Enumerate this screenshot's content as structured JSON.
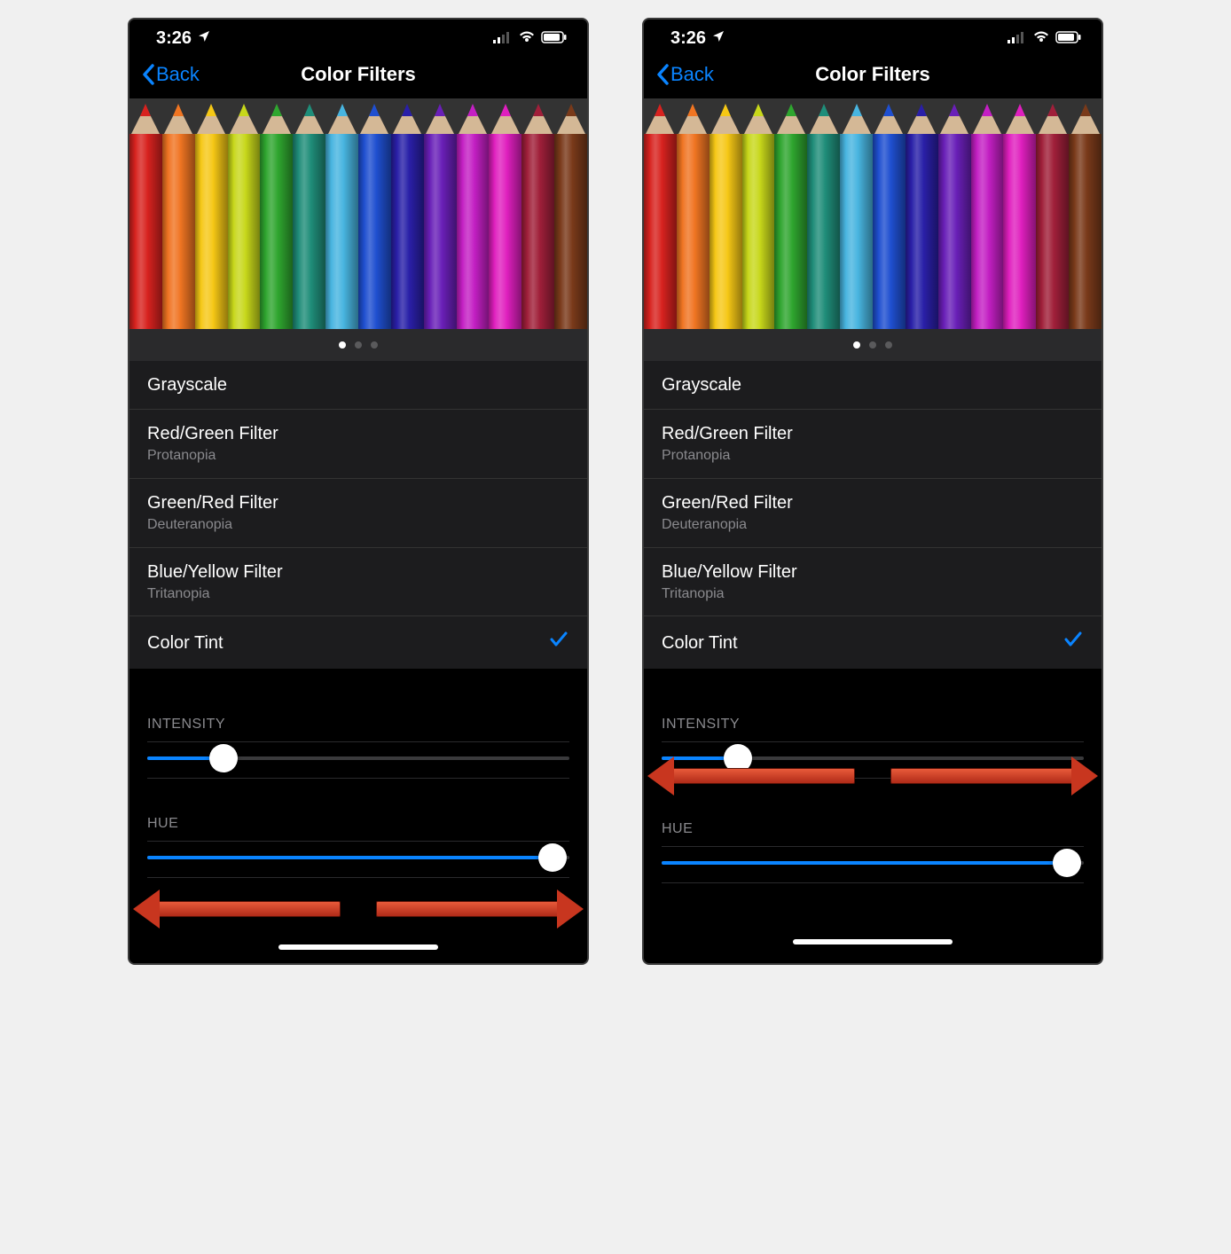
{
  "screens": [
    {
      "status": {
        "time": "3:26"
      },
      "nav": {
        "back": "Back",
        "title": "Color Filters"
      },
      "pencil_colors": [
        "#d8221f",
        "#f07522",
        "#f6c815",
        "#c8d81a",
        "#2fa62f",
        "#1f8e7a",
        "#48b5e0",
        "#1f4fd0",
        "#2a1fa8",
        "#6a1fb8",
        "#c41fc4",
        "#e01fbf",
        "#a01f3a",
        "#7a3a1a"
      ],
      "page_dots": {
        "count": 3,
        "active": 0
      },
      "filters": [
        {
          "label": "Grayscale",
          "sub": "",
          "checked": false
        },
        {
          "label": "Red/Green Filter",
          "sub": "Protanopia",
          "checked": false
        },
        {
          "label": "Green/Red Filter",
          "sub": "Deuteranopia",
          "checked": false
        },
        {
          "label": "Blue/Yellow Filter",
          "sub": "Tritanopia",
          "checked": false
        },
        {
          "label": "Color Tint",
          "sub": "",
          "checked": true
        }
      ],
      "sliders": {
        "intensity": {
          "header": "INTENSITY",
          "value": 0.18
        },
        "hue": {
          "header": "HUE",
          "value": 0.96
        }
      },
      "arrows_on": "hue"
    },
    {
      "status": {
        "time": "3:26"
      },
      "nav": {
        "back": "Back",
        "title": "Color Filters"
      },
      "pencil_colors": [
        "#d8221f",
        "#f07522",
        "#f6c815",
        "#c8d81a",
        "#2fa62f",
        "#1f8e7a",
        "#48b5e0",
        "#1f4fd0",
        "#2a1fa8",
        "#6a1fb8",
        "#c41fc4",
        "#e01fbf",
        "#a01f3a",
        "#7a3a1a"
      ],
      "page_dots": {
        "count": 3,
        "active": 0
      },
      "filters": [
        {
          "label": "Grayscale",
          "sub": "",
          "checked": false
        },
        {
          "label": "Red/Green Filter",
          "sub": "Protanopia",
          "checked": false
        },
        {
          "label": "Green/Red Filter",
          "sub": "Deuteranopia",
          "checked": false
        },
        {
          "label": "Blue/Yellow Filter",
          "sub": "Tritanopia",
          "checked": false
        },
        {
          "label": "Color Tint",
          "sub": "",
          "checked": true
        }
      ],
      "sliders": {
        "intensity": {
          "header": "INTENSITY",
          "value": 0.18
        },
        "hue": {
          "header": "HUE",
          "value": 0.96
        }
      },
      "arrows_on": "intensity"
    }
  ]
}
